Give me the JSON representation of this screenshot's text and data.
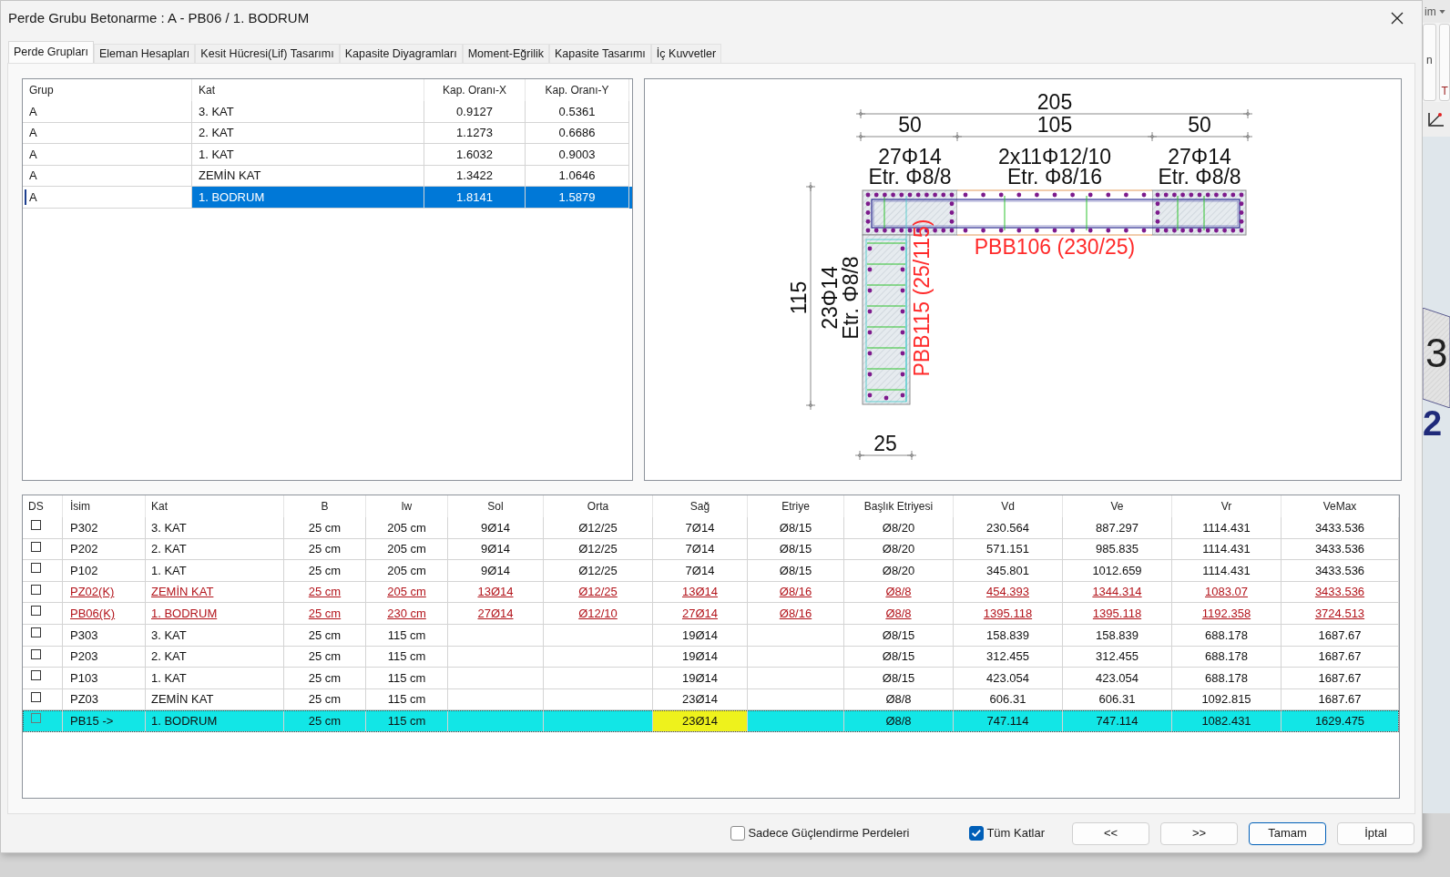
{
  "window": {
    "title": "Perde Grubu Betonarme : A - PB06 / 1. BODRUM"
  },
  "tabs": [
    {
      "label": "Perde Grupları",
      "selected": true
    },
    {
      "label": "Eleman Hesapları",
      "selected": false
    },
    {
      "label": "Kesit Hücresi(Lif) Tasarımı",
      "selected": false
    },
    {
      "label": "Kapasite Diyagramları",
      "selected": false
    },
    {
      "label": "Moment-Eğrilik",
      "selected": false
    },
    {
      "label": "Kapasite Tasarımı",
      "selected": false
    },
    {
      "label": "İç Kuvvetler",
      "selected": false
    }
  ],
  "group_table": {
    "columns": [
      "Grup",
      "Kat",
      "Kap. Oranı-X",
      "Kap. Oranı-Y"
    ],
    "rows": [
      {
        "selected": false,
        "cells": [
          {
            "text": "A",
            "focused": false
          },
          {
            "text": "3. KAT",
            "focused": false
          },
          {
            "text": "0.9127",
            "focused": false
          },
          {
            "text": "0.5361",
            "focused": false
          }
        ]
      },
      {
        "selected": false,
        "cells": [
          {
            "text": "A",
            "focused": false
          },
          {
            "text": "2. KAT",
            "focused": false
          },
          {
            "text": "1.1273",
            "focused": false
          },
          {
            "text": "0.6686",
            "focused": false
          }
        ]
      },
      {
        "selected": false,
        "cells": [
          {
            "text": "A",
            "focused": false
          },
          {
            "text": "1. KAT",
            "focused": false
          },
          {
            "text": "1.6032",
            "focused": false
          },
          {
            "text": "0.9003",
            "focused": false
          }
        ]
      },
      {
        "selected": false,
        "cells": [
          {
            "text": "A",
            "focused": false
          },
          {
            "text": "ZEMİN KAT",
            "focused": false
          },
          {
            "text": "1.3422",
            "focused": false
          },
          {
            "text": "1.0646",
            "focused": false
          }
        ]
      },
      {
        "selected": true,
        "cells": [
          {
            "text": "A",
            "focused": true
          },
          {
            "text": "1. BODRUM",
            "focused": false
          },
          {
            "text": "1.8141",
            "focused": false
          },
          {
            "text": "1.5879",
            "focused": false
          }
        ]
      }
    ]
  },
  "section_drawing": {
    "total_width_dimension": "205",
    "segment_dimensions": [
      "50",
      "105",
      "50"
    ],
    "segment_labels": [
      {
        "bars": "27Φ14",
        "stirrups": "Etr. Φ8/8"
      },
      {
        "bars": "2x11Φ12/10",
        "stirrups": "Etr. Φ8/16"
      },
      {
        "bars": "27Φ14",
        "stirrups": "Etr. Φ8/8"
      }
    ],
    "flange_name": "PBB106 (230/25)",
    "web_height_dimension": "115",
    "web_label": {
      "bars": "23Φ14",
      "stirrups": "Etr. Φ8/8"
    },
    "web_name": "PBB115 (25/115)",
    "web_width_dimension": "25"
  },
  "wall_table": {
    "columns": [
      "DS",
      "İsim",
      "Kat",
      "B",
      "lw",
      "Sol",
      "Orta",
      "Sağ",
      "Etriye",
      "Başlık Etriyesi",
      "Vd",
      "Ve",
      "Vr",
      "VeMax"
    ],
    "rows": [
      {
        "selected": false,
        "kind": "plain",
        "cells": [
          {
            "checked": false,
            "focused": false
          },
          {
            "text": "P302",
            "focused": false
          },
          {
            "text": "3. KAT",
            "focused": false
          },
          {
            "text": "25 cm",
            "focused": false
          },
          {
            "text": "205 cm",
            "focused": false
          },
          {
            "text": "9Ø14",
            "focused": false
          },
          {
            "text": "Ø12/25",
            "focused": false
          },
          {
            "text": "7Ø14",
            "focused": false
          },
          {
            "text": "Ø8/15",
            "focused": false
          },
          {
            "text": "Ø8/20",
            "focused": false
          },
          {
            "text": "230.564",
            "focused": false
          },
          {
            "text": "887.297",
            "focused": false
          },
          {
            "text": "1114.431",
            "focused": false
          },
          {
            "text": "3433.536",
            "focused": false
          }
        ]
      },
      {
        "selected": false,
        "kind": "plain",
        "cells": [
          {
            "checked": false,
            "focused": false
          },
          {
            "text": "P202",
            "focused": false
          },
          {
            "text": "2. KAT",
            "focused": false
          },
          {
            "text": "25 cm",
            "focused": false
          },
          {
            "text": "205 cm",
            "focused": false
          },
          {
            "text": "9Ø14",
            "focused": false
          },
          {
            "text": "Ø12/25",
            "focused": false
          },
          {
            "text": "7Ø14",
            "focused": false
          },
          {
            "text": "Ø8/15",
            "focused": false
          },
          {
            "text": "Ø8/20",
            "focused": false
          },
          {
            "text": "571.151",
            "focused": false
          },
          {
            "text": "985.835",
            "focused": false
          },
          {
            "text": "1114.431",
            "focused": false
          },
          {
            "text": "3433.536",
            "focused": false
          }
        ]
      },
      {
        "selected": false,
        "kind": "plain",
        "cells": [
          {
            "checked": false,
            "focused": false
          },
          {
            "text": "P102",
            "focused": false
          },
          {
            "text": "1. KAT",
            "focused": false
          },
          {
            "text": "25 cm",
            "focused": false
          },
          {
            "text": "205 cm",
            "focused": false
          },
          {
            "text": "9Ø14",
            "focused": false
          },
          {
            "text": "Ø12/25",
            "focused": false
          },
          {
            "text": "7Ø14",
            "focused": false
          },
          {
            "text": "Ø8/15",
            "focused": false
          },
          {
            "text": "Ø8/20",
            "focused": false
          },
          {
            "text": "345.801",
            "focused": false
          },
          {
            "text": "1012.659",
            "focused": false
          },
          {
            "text": "1114.431",
            "focused": false
          },
          {
            "text": "3433.536",
            "focused": false
          }
        ]
      },
      {
        "selected": false,
        "kind": "link",
        "cells": [
          {
            "checked": false,
            "focused": false
          },
          {
            "text": "PZ02(K)",
            "focused": false
          },
          {
            "text": "ZEMİN KAT",
            "focused": false
          },
          {
            "text": "25 cm",
            "focused": false
          },
          {
            "text": "205 cm",
            "focused": false
          },
          {
            "text": "13Ø14",
            "focused": false
          },
          {
            "text": "Ø12/25",
            "focused": false
          },
          {
            "text": "13Ø14",
            "focused": false
          },
          {
            "text": "Ø8/16",
            "focused": false
          },
          {
            "text": "Ø8/8",
            "focused": false
          },
          {
            "text": "454.393",
            "focused": false
          },
          {
            "text": "1344.314",
            "focused": false
          },
          {
            "text": "1083.07",
            "focused": false
          },
          {
            "text": "3433.536",
            "focused": false
          }
        ]
      },
      {
        "selected": false,
        "kind": "link",
        "cells": [
          {
            "checked": false,
            "focused": false
          },
          {
            "text": "PB06(K)",
            "focused": false
          },
          {
            "text": "1. BODRUM",
            "focused": false
          },
          {
            "text": "25 cm",
            "focused": false
          },
          {
            "text": "230 cm",
            "focused": false
          },
          {
            "text": "27Ø14",
            "focused": false
          },
          {
            "text": "Ø12/10",
            "focused": false
          },
          {
            "text": "27Ø14",
            "focused": false
          },
          {
            "text": "Ø8/16",
            "focused": false
          },
          {
            "text": "Ø8/8",
            "focused": false
          },
          {
            "text": "1395.118",
            "focused": false
          },
          {
            "text": "1395.118",
            "focused": false
          },
          {
            "text": "1192.358",
            "focused": false
          },
          {
            "text": "3724.513",
            "focused": false
          }
        ]
      },
      {
        "selected": false,
        "kind": "plain",
        "cells": [
          {
            "checked": false,
            "focused": false
          },
          {
            "text": "P303",
            "focused": false
          },
          {
            "text": "3. KAT",
            "focused": false
          },
          {
            "text": "25 cm",
            "focused": false
          },
          {
            "text": "115 cm",
            "focused": false
          },
          {
            "focused": false
          },
          {
            "focused": false
          },
          {
            "text": "19Ø14",
            "focused": false
          },
          {
            "focused": false
          },
          {
            "text": "Ø8/15",
            "focused": false
          },
          {
            "text": "158.839",
            "focused": false
          },
          {
            "text": "158.839",
            "focused": false
          },
          {
            "text": "688.178",
            "focused": false
          },
          {
            "text": "1687.67",
            "focused": false
          }
        ]
      },
      {
        "selected": false,
        "kind": "plain",
        "cells": [
          {
            "checked": false,
            "focused": false
          },
          {
            "text": "P203",
            "focused": false
          },
          {
            "text": "2. KAT",
            "focused": false
          },
          {
            "text": "25 cm",
            "focused": false
          },
          {
            "text": "115 cm",
            "focused": false
          },
          {
            "focused": false
          },
          {
            "focused": false
          },
          {
            "text": "19Ø14",
            "focused": false
          },
          {
            "focused": false
          },
          {
            "text": "Ø8/15",
            "focused": false
          },
          {
            "text": "312.455",
            "focused": false
          },
          {
            "text": "312.455",
            "focused": false
          },
          {
            "text": "688.178",
            "focused": false
          },
          {
            "text": "1687.67",
            "focused": false
          }
        ]
      },
      {
        "selected": false,
        "kind": "plain",
        "cells": [
          {
            "checked": false,
            "focused": false
          },
          {
            "text": "P103",
            "focused": false
          },
          {
            "text": "1. KAT",
            "focused": false
          },
          {
            "text": "25 cm",
            "focused": false
          },
          {
            "text": "115 cm",
            "focused": false
          },
          {
            "focused": false
          },
          {
            "focused": false
          },
          {
            "text": "19Ø14",
            "focused": false
          },
          {
            "focused": false
          },
          {
            "text": "Ø8/15",
            "focused": false
          },
          {
            "text": "423.054",
            "focused": false
          },
          {
            "text": "423.054",
            "focused": false
          },
          {
            "text": "688.178",
            "focused": false
          },
          {
            "text": "1687.67",
            "focused": false
          }
        ]
      },
      {
        "selected": false,
        "kind": "plain",
        "cells": [
          {
            "checked": false,
            "focused": false
          },
          {
            "text": "PZ03",
            "focused": false
          },
          {
            "text": "ZEMİN KAT",
            "focused": false
          },
          {
            "text": "25 cm",
            "focused": false
          },
          {
            "text": "115 cm",
            "focused": false
          },
          {
            "focused": false
          },
          {
            "focused": false
          },
          {
            "text": "23Ø14",
            "focused": false
          },
          {
            "focused": false
          },
          {
            "text": "Ø8/8",
            "focused": false
          },
          {
            "text": "606.31",
            "focused": false
          },
          {
            "text": "606.31",
            "focused": false
          },
          {
            "text": "1092.815",
            "focused": false
          },
          {
            "text": "1687.67",
            "focused": false
          }
        ]
      },
      {
        "selected": true,
        "kind": "plain",
        "cells": [
          {
            "checked": false,
            "focused": false
          },
          {
            "text": "PB15 ->",
            "focused": false
          },
          {
            "text": "1. BODRUM",
            "focused": false
          },
          {
            "text": "25 cm",
            "focused": false
          },
          {
            "text": "115 cm",
            "focused": false
          },
          {
            "focused": false
          },
          {
            "focused": false
          },
          {
            "text": "23Ø14",
            "focused": true
          },
          {
            "focused": false
          },
          {
            "text": "Ø8/8",
            "focused": false
          },
          {
            "text": "747.114",
            "focused": false
          },
          {
            "text": "747.114",
            "focused": false
          },
          {
            "text": "1082.431",
            "focused": false
          },
          {
            "text": "1629.475",
            "focused": false
          }
        ]
      }
    ]
  },
  "options": [
    {
      "label": "Sadece Güçlendirme Perdeleri",
      "checked": false
    },
    {
      "label": "Tüm Katlar",
      "checked": true
    }
  ],
  "buttons": [
    {
      "label": "<<",
      "default": false
    },
    {
      "label": ">>",
      "default": false
    },
    {
      "label": "Tamam",
      "default": true
    },
    {
      "label": "İptal",
      "default": false
    }
  ],
  "background_app": {
    "menu_text": "im",
    "ribbon_texts": [
      "n",
      "T"
    ],
    "canvas_texts": [
      "3",
      "2"
    ]
  }
}
